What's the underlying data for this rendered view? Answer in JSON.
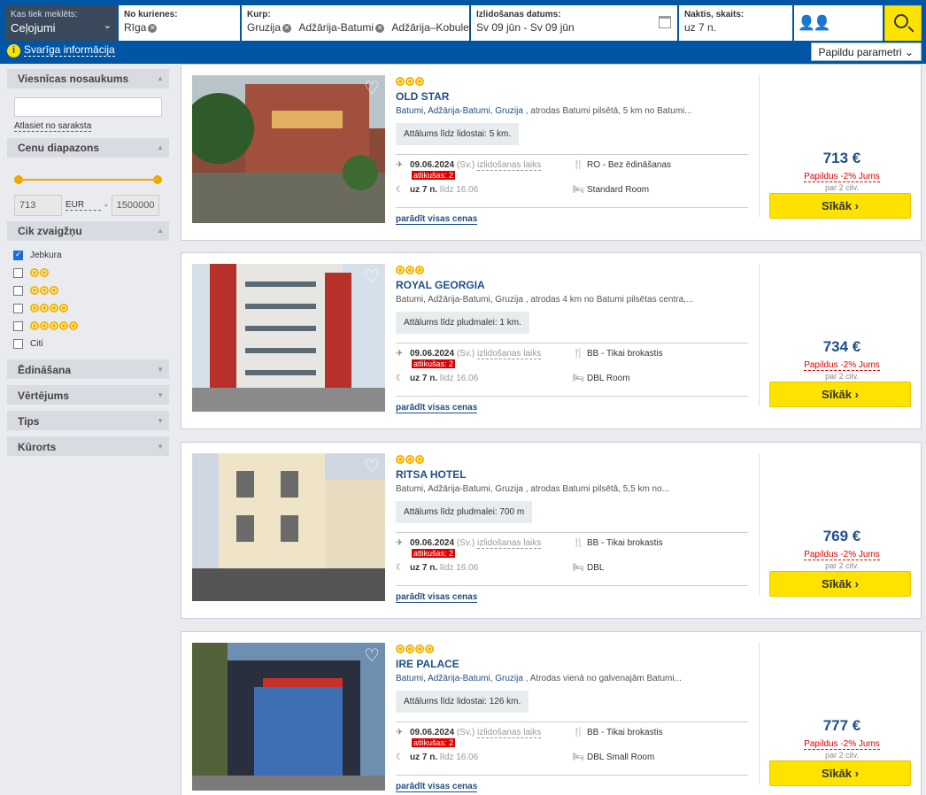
{
  "search": {
    "type_label": "Kas tiek meklēts:",
    "type_value": "Ceļojumi",
    "from_label": "No kurienes:",
    "from_value": "Rīga",
    "to_label": "Kurp:",
    "to_chips": [
      "Gruzija",
      "Adžārija-Batumi",
      "Adžārija–Kobuleti"
    ],
    "date_label": "Izlidošanas datums:",
    "date_value": "Sv 09 jūn - Sv 09 jūn",
    "nights_label": "Naktis, skaits:",
    "nights_value": "uz 7 n."
  },
  "subbar": {
    "info_label": "Svarīga informācija",
    "more_params": "Papildu parametri"
  },
  "sidebar": {
    "hotel_name_title": "Viesnīcas nosaukums",
    "select_from_list": "Atlasiet no saraksta",
    "price_title": "Cenu diapazons",
    "price_min": "713",
    "currency": "EUR",
    "price_sep": "-",
    "price_max": "1500000",
    "stars_title": "Cik zvaigžņu",
    "any_label": "Jebkura",
    "other_label": "Citi",
    "collapsed": [
      "Ēdināšana",
      "Vērtējums",
      "Tips",
      "Kūrorts"
    ]
  },
  "common": {
    "departure_date": "09.06.2024",
    "day": "(Sv.)",
    "departure_time": "izlidošanas laiks",
    "remaining": "atlikušas: 2",
    "nights": "uz 7 n.",
    "until": "līdz 16.06",
    "all_prices": "parādīt visas cenas",
    "extra": "Papildus -2% Jums",
    "per": "par 2 cilv.",
    "more_btn": "Sīkāk"
  },
  "hotels": [
    {
      "stars": 3,
      "name": "OLD STAR",
      "loc_link": "Batumi, Adžārija-Batumi, Gruzija",
      "loc_text": ", atrodas Batumi pilsētā, 5 km no Batumi...",
      "distance": "Attālums līdz lidostai: 5 km.",
      "meal": "RO - Bez ēdināšanas",
      "room": "Standard Room",
      "price": "713 €"
    },
    {
      "stars": 3,
      "name": "ROYAL GEORGIA",
      "loc_link": "",
      "loc_text": "Batumi, Adžārija-Batumi, Gruzija , atrodas 4 km no Batumi pilsētas centra,...",
      "distance": "Attālums līdz pludmalei: 1 km.",
      "meal": "BB - Tikai brokastis",
      "room": "DBL Room",
      "price": "734 €"
    },
    {
      "stars": 3,
      "name": "RITSA HOTEL",
      "loc_link": "",
      "loc_text": "Batumi, Adžārija-Batumi, Gruzija , atrodas Batumi pilsētā, 5,5 km no...",
      "distance": "Attālums līdz pludmalei: 700 m",
      "meal": "BB - Tikai brokastis",
      "room": "DBL",
      "price": "769 €"
    },
    {
      "stars": 4,
      "name": "IRE PALACE",
      "loc_link": "Batumi, Adžārija-Batumi, Gruzija",
      "loc_text": ", Atrodas vienā no galvenajām Batumi...",
      "distance": "Attālums līdz lidostai: 126 km.",
      "meal": "BB - Tikai brokastis",
      "room": "DBL Small Room",
      "price": "777 €"
    }
  ]
}
